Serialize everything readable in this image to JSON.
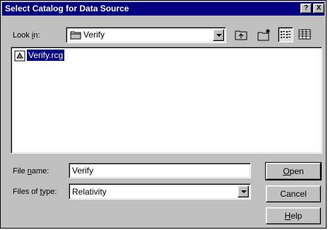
{
  "window": {
    "title": "Select Catalog for Data Source"
  },
  "titlebar": {
    "help_glyph": "?",
    "close_glyph": "X"
  },
  "lookin": {
    "label_pre": "Look ",
    "label_accel": "i",
    "label_post": "n:",
    "value": "Verify"
  },
  "toolbar": {
    "icons": [
      "up-folder-icon",
      "new-folder-icon",
      "list-view-icon",
      "details-view-icon"
    ]
  },
  "files": [
    {
      "name": "Verify.rcg",
      "selected": true
    }
  ],
  "filename": {
    "label_pre": "File ",
    "label_accel": "n",
    "label_post": "ame:",
    "value": "Verify"
  },
  "filetype": {
    "label_pre": "Files of ",
    "label_accel": "t",
    "label_post": "ype:",
    "value": "Relativity"
  },
  "buttons": {
    "open_accel": "O",
    "open_rest": "pen",
    "cancel": "Cancel",
    "help_accel": "H",
    "help_rest": "elp"
  },
  "colors": {
    "titlebar": "#000080",
    "face": "#c0c0c0",
    "selection": "#000080"
  }
}
